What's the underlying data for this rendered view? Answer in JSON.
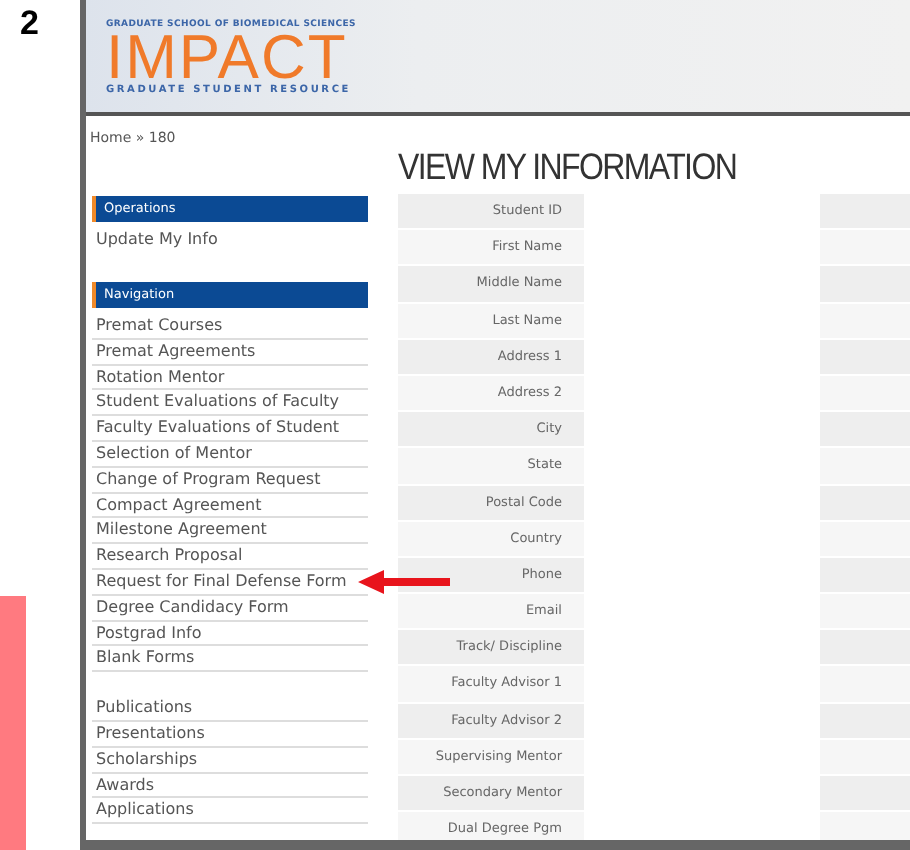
{
  "figure_label": "2",
  "header": {
    "school": "GRADUATE SCHOOL OF BIOMEDICAL SCIENCES",
    "logo": "IMPACT",
    "tagline": "GRADUATE STUDENT RESOURCE"
  },
  "breadcrumb": "Home » 180",
  "sidebar": {
    "operations": {
      "title": "Operations",
      "items": [
        "Update My Info"
      ]
    },
    "navigation": {
      "title": "Navigation",
      "groups": [
        [
          {
            "label": "Premat Courses",
            "arrow": false
          },
          {
            "label": "Premat Agreements",
            "arrow": false
          },
          {
            "label": "Rotation Mentor",
            "arrow": false
          },
          {
            "label": "Student Evaluations of Faculty",
            "arrow": false
          },
          {
            "label": "Faculty Evaluations of Student",
            "arrow": false
          },
          {
            "label": "Selection of Mentor",
            "arrow": false
          },
          {
            "label": "Change of Program Request",
            "arrow": false
          },
          {
            "label": "Compact Agreement",
            "arrow": false
          },
          {
            "label": "Milestone Agreement",
            "arrow": false
          },
          {
            "label": "Research Proposal",
            "arrow": false
          },
          {
            "label": "Request for Final Defense Form",
            "arrow": true
          },
          {
            "label": "Degree Candidacy Form",
            "arrow": false
          },
          {
            "label": "Postgrad Info",
            "arrow": false
          },
          {
            "label": "Blank Forms",
            "arrow": false
          }
        ],
        [
          {
            "label": "Publications",
            "arrow": false
          },
          {
            "label": "Presentations",
            "arrow": false
          },
          {
            "label": "Scholarships",
            "arrow": false
          },
          {
            "label": "Awards",
            "arrow": false
          },
          {
            "label": "Applications",
            "arrow": false
          }
        ]
      ]
    }
  },
  "main": {
    "title": "VIEW MY INFORMATION",
    "fields": [
      "Student ID",
      "First Name",
      "Middle Name",
      "Last Name",
      "Address 1",
      "Address 2",
      "City",
      "State",
      "Postal Code",
      "Country",
      "Phone",
      "Email",
      "Track/ Discipline",
      "Faculty Advisor 1",
      "Faculty Advisor 2",
      "Supervising Mentor",
      "Secondary Mentor",
      "Dual Degree Pgm"
    ]
  }
}
